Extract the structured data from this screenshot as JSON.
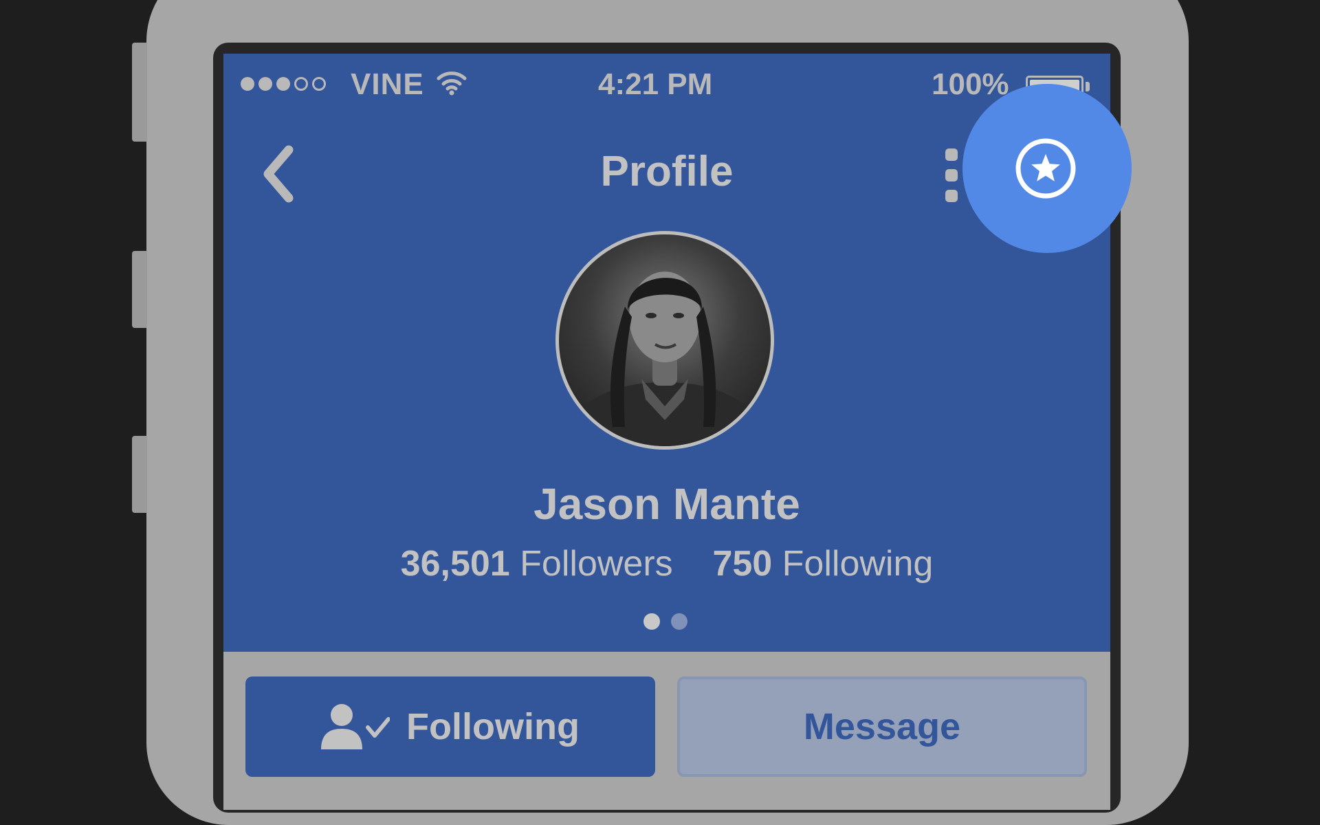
{
  "status_bar": {
    "carrier": "VINE",
    "time": "4:21 PM",
    "battery": "100%",
    "signal_bars_filled": 3,
    "signal_bars_total": 5
  },
  "nav": {
    "title": "Profile",
    "back_icon": "chevron-left-icon",
    "menu_icon": "vertical-dots-icon",
    "favorite_icon": "star-circle-icon"
  },
  "profile": {
    "name": "Jason Mante",
    "followers_count": "36,501",
    "followers_label": "Followers",
    "following_count": "750",
    "following_label": "Following",
    "page_indicator_total": 2,
    "page_indicator_active": 1
  },
  "actions": {
    "following_label": "Following",
    "following_icon": "user-check-icon",
    "message_label": "Message"
  },
  "colors": {
    "header_blue": "#33559a",
    "highlight_blue": "#5389e6",
    "muted_text": "#c2c2c2",
    "device_gray": "#a6a6a6"
  }
}
